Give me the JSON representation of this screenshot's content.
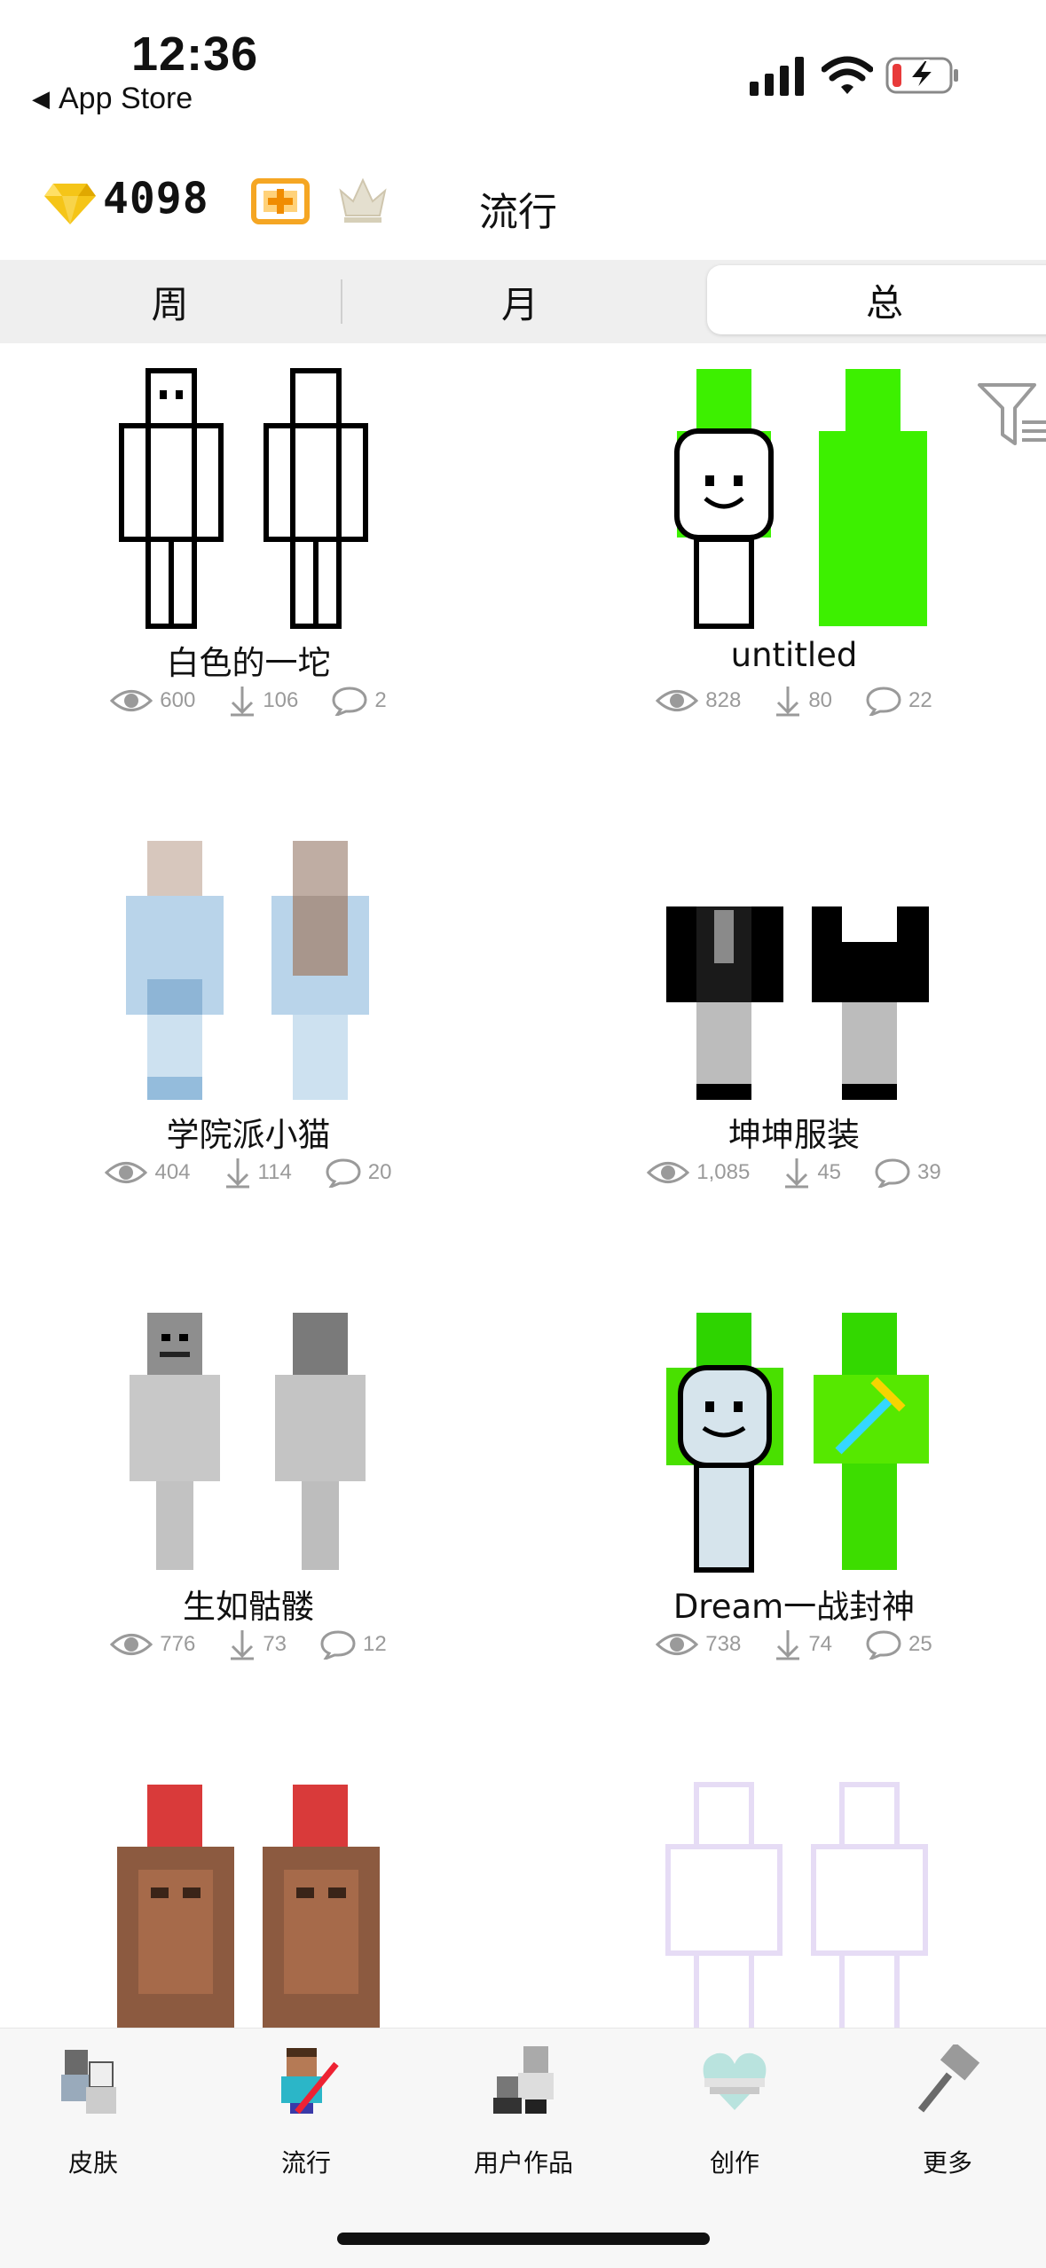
{
  "status_bar": {
    "time": "12:36",
    "back_label": "App Store"
  },
  "header": {
    "coins": "4098",
    "title": "流行"
  },
  "tabs": [
    {
      "label": "周"
    },
    {
      "label": "月"
    },
    {
      "label": "总",
      "selected": true
    }
  ],
  "skins": [
    {
      "name": "白色的一坨",
      "views": "600",
      "downloads": "106",
      "comments": "2"
    },
    {
      "name": "untitled",
      "views": "828",
      "downloads": "80",
      "comments": "22"
    },
    {
      "name": "学院派小猫",
      "views": "404",
      "downloads": "114",
      "comments": "20"
    },
    {
      "name": "坤坤服装",
      "views": "1,085",
      "downloads": "45",
      "comments": "39"
    },
    {
      "name": "生如骷髅",
      "views": "776",
      "downloads": "73",
      "comments": "12"
    },
    {
      "name": "Dream一战封神",
      "views": "738",
      "downloads": "74",
      "comments": "25"
    }
  ],
  "bottom_nav": [
    {
      "label": "皮肤",
      "icon": "skins-icon"
    },
    {
      "label": "流行",
      "icon": "steve-icon"
    },
    {
      "label": "用户作品",
      "icon": "user-works-icon"
    },
    {
      "label": "创作",
      "icon": "heart-icon"
    },
    {
      "label": "更多",
      "icon": "hammer-icon"
    }
  ],
  "colors": {
    "accent_gold": "#f5c518",
    "green": "#3df000",
    "bg_tabs": "#efefef"
  }
}
